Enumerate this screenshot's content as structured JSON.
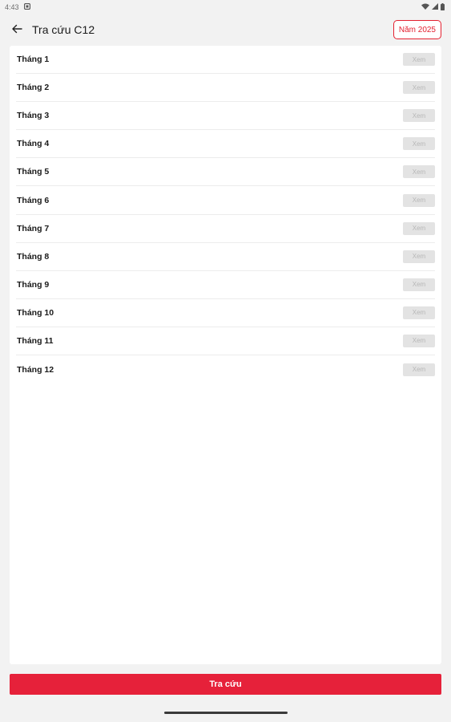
{
  "status_bar": {
    "time": "4:43",
    "icons": [
      "notification-icon",
      "wifi-icon",
      "signal-icon",
      "battery-icon"
    ]
  },
  "app_bar": {
    "title": "Tra cứu C12",
    "back_icon": "arrow-left-icon",
    "year_chip": "Năm 2025"
  },
  "months": [
    {
      "label": "Tháng 1",
      "action": "Xem"
    },
    {
      "label": "Tháng 2",
      "action": "Xem"
    },
    {
      "label": "Tháng 3",
      "action": "Xem"
    },
    {
      "label": "Tháng 4",
      "action": "Xem"
    },
    {
      "label": "Tháng 5",
      "action": "Xem"
    },
    {
      "label": "Tháng 6",
      "action": "Xem"
    },
    {
      "label": "Tháng 7",
      "action": "Xem"
    },
    {
      "label": "Tháng 8",
      "action": "Xem"
    },
    {
      "label": "Tháng 9",
      "action": "Xem"
    },
    {
      "label": "Tháng 10",
      "action": "Xem"
    },
    {
      "label": "Tháng 11",
      "action": "Xem"
    },
    {
      "label": "Tháng 12",
      "action": "Xem"
    }
  ],
  "primary_action": "Tra cứu",
  "colors": {
    "accent": "#e6213a",
    "chip_border": "#e4202f",
    "disabled_button_bg": "#e3e3e3",
    "disabled_button_text": "#b7b7b7",
    "background": "#f2f2f2"
  }
}
